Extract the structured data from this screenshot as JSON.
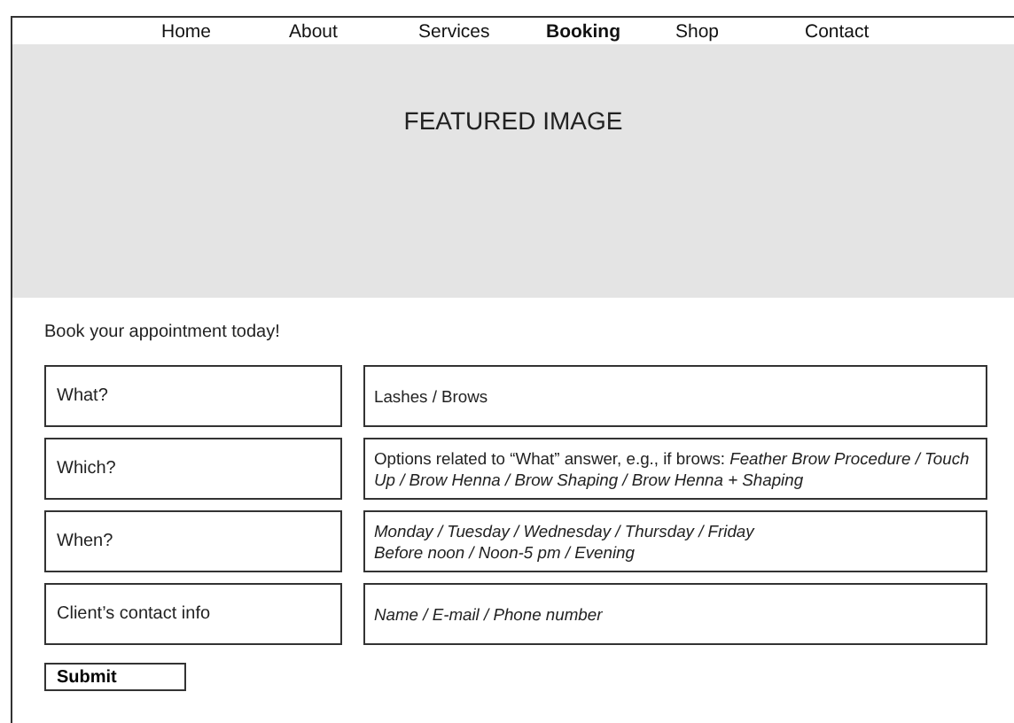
{
  "nav": [
    {
      "label": "Home",
      "selected": false
    },
    {
      "label": "About",
      "selected": false
    },
    {
      "label": "Services",
      "selected": false
    },
    {
      "label": "Booking",
      "selected": true
    },
    {
      "label": "Shop",
      "selected": false
    },
    {
      "label": "Contact",
      "selected": false
    }
  ],
  "hero": {
    "title": "FEATURED IMAGE"
  },
  "form": {
    "heading": "Book your appointment today!",
    "rows": [
      {
        "label": "What?",
        "kind": "plain",
        "lines": [
          "Lashes / Brows"
        ]
      },
      {
        "label": "Which?",
        "kind": "plain",
        "lines": [
          "Options related to “What” answer, e.g., if brows: *Feather Brow Procedure / Touch Up / Brow Henna / Brow Shaping / Brow Henna + Shaping*"
        ]
      },
      {
        "label": "When?",
        "kind": "hint",
        "lines": [
          "Monday / Tuesday / Wednesday / Thursday / Friday",
          "Before noon / Noon-5 pm / Evening"
        ]
      },
      {
        "label": "Client’s contact info",
        "kind": "hint",
        "lines": [
          "Name / E-mail / Phone number"
        ]
      }
    ],
    "submit": "Submit"
  }
}
